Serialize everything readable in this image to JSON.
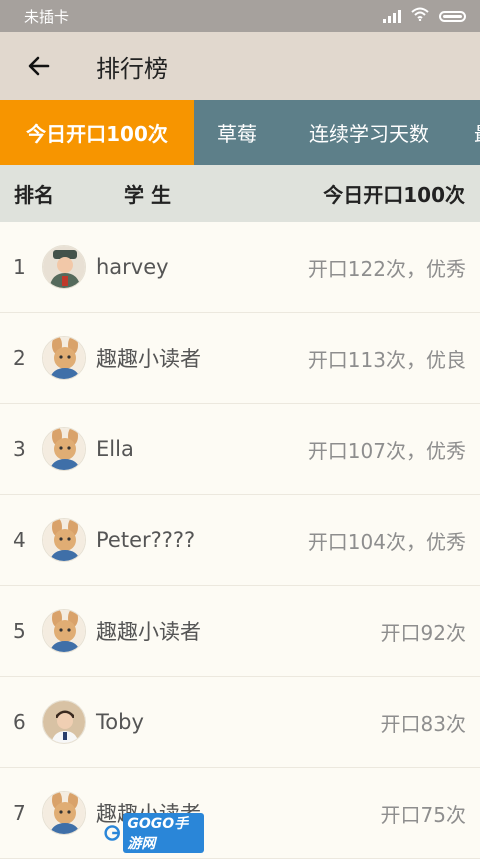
{
  "status_bar": {
    "carrier": "未插卡",
    "icons": [
      "signal-icon",
      "wifi-icon",
      "battery-icon"
    ]
  },
  "app_bar": {
    "back_icon": "arrow-left-icon",
    "title": "排行榜"
  },
  "tabs": [
    {
      "label": "今日开口100次",
      "active": true
    },
    {
      "label": "草莓",
      "active": false
    },
    {
      "label": "连续学习天数",
      "active": false
    },
    {
      "label": "最",
      "active": false
    }
  ],
  "table_header": {
    "rank": "排名",
    "student": "学 生",
    "count": "今日开口100次"
  },
  "rows": [
    {
      "rank": "1",
      "name": "harvey",
      "result": "开口122次，优秀",
      "avatar": "boy-uniform"
    },
    {
      "rank": "2",
      "name": "趣趣小读者",
      "result": "开口113次，优良",
      "avatar": "rabbit"
    },
    {
      "rank": "3",
      "name": "Ella",
      "result": "开口107次，优秀",
      "avatar": "rabbit"
    },
    {
      "rank": "4",
      "name": "Peter????",
      "result": "开口104次，优秀",
      "avatar": "rabbit"
    },
    {
      "rank": "5",
      "name": "趣趣小读者",
      "result": "开口92次",
      "avatar": "rabbit"
    },
    {
      "rank": "6",
      "name": "Toby",
      "result": "开口83次",
      "avatar": "boy-photo"
    },
    {
      "rank": "7",
      "name": "趣趣小读者",
      "result": "开口75次",
      "avatar": "rabbit"
    }
  ],
  "watermark": {
    "text": "GOGO手游网"
  },
  "colors": {
    "status_bar": "#a6a19d",
    "app_bar": "#e1d8ce",
    "tab_bar": "#5d7f89",
    "tab_active": "#f79500",
    "header_bg": "#dfe2dc",
    "list_bg": "#fdfbf4"
  }
}
